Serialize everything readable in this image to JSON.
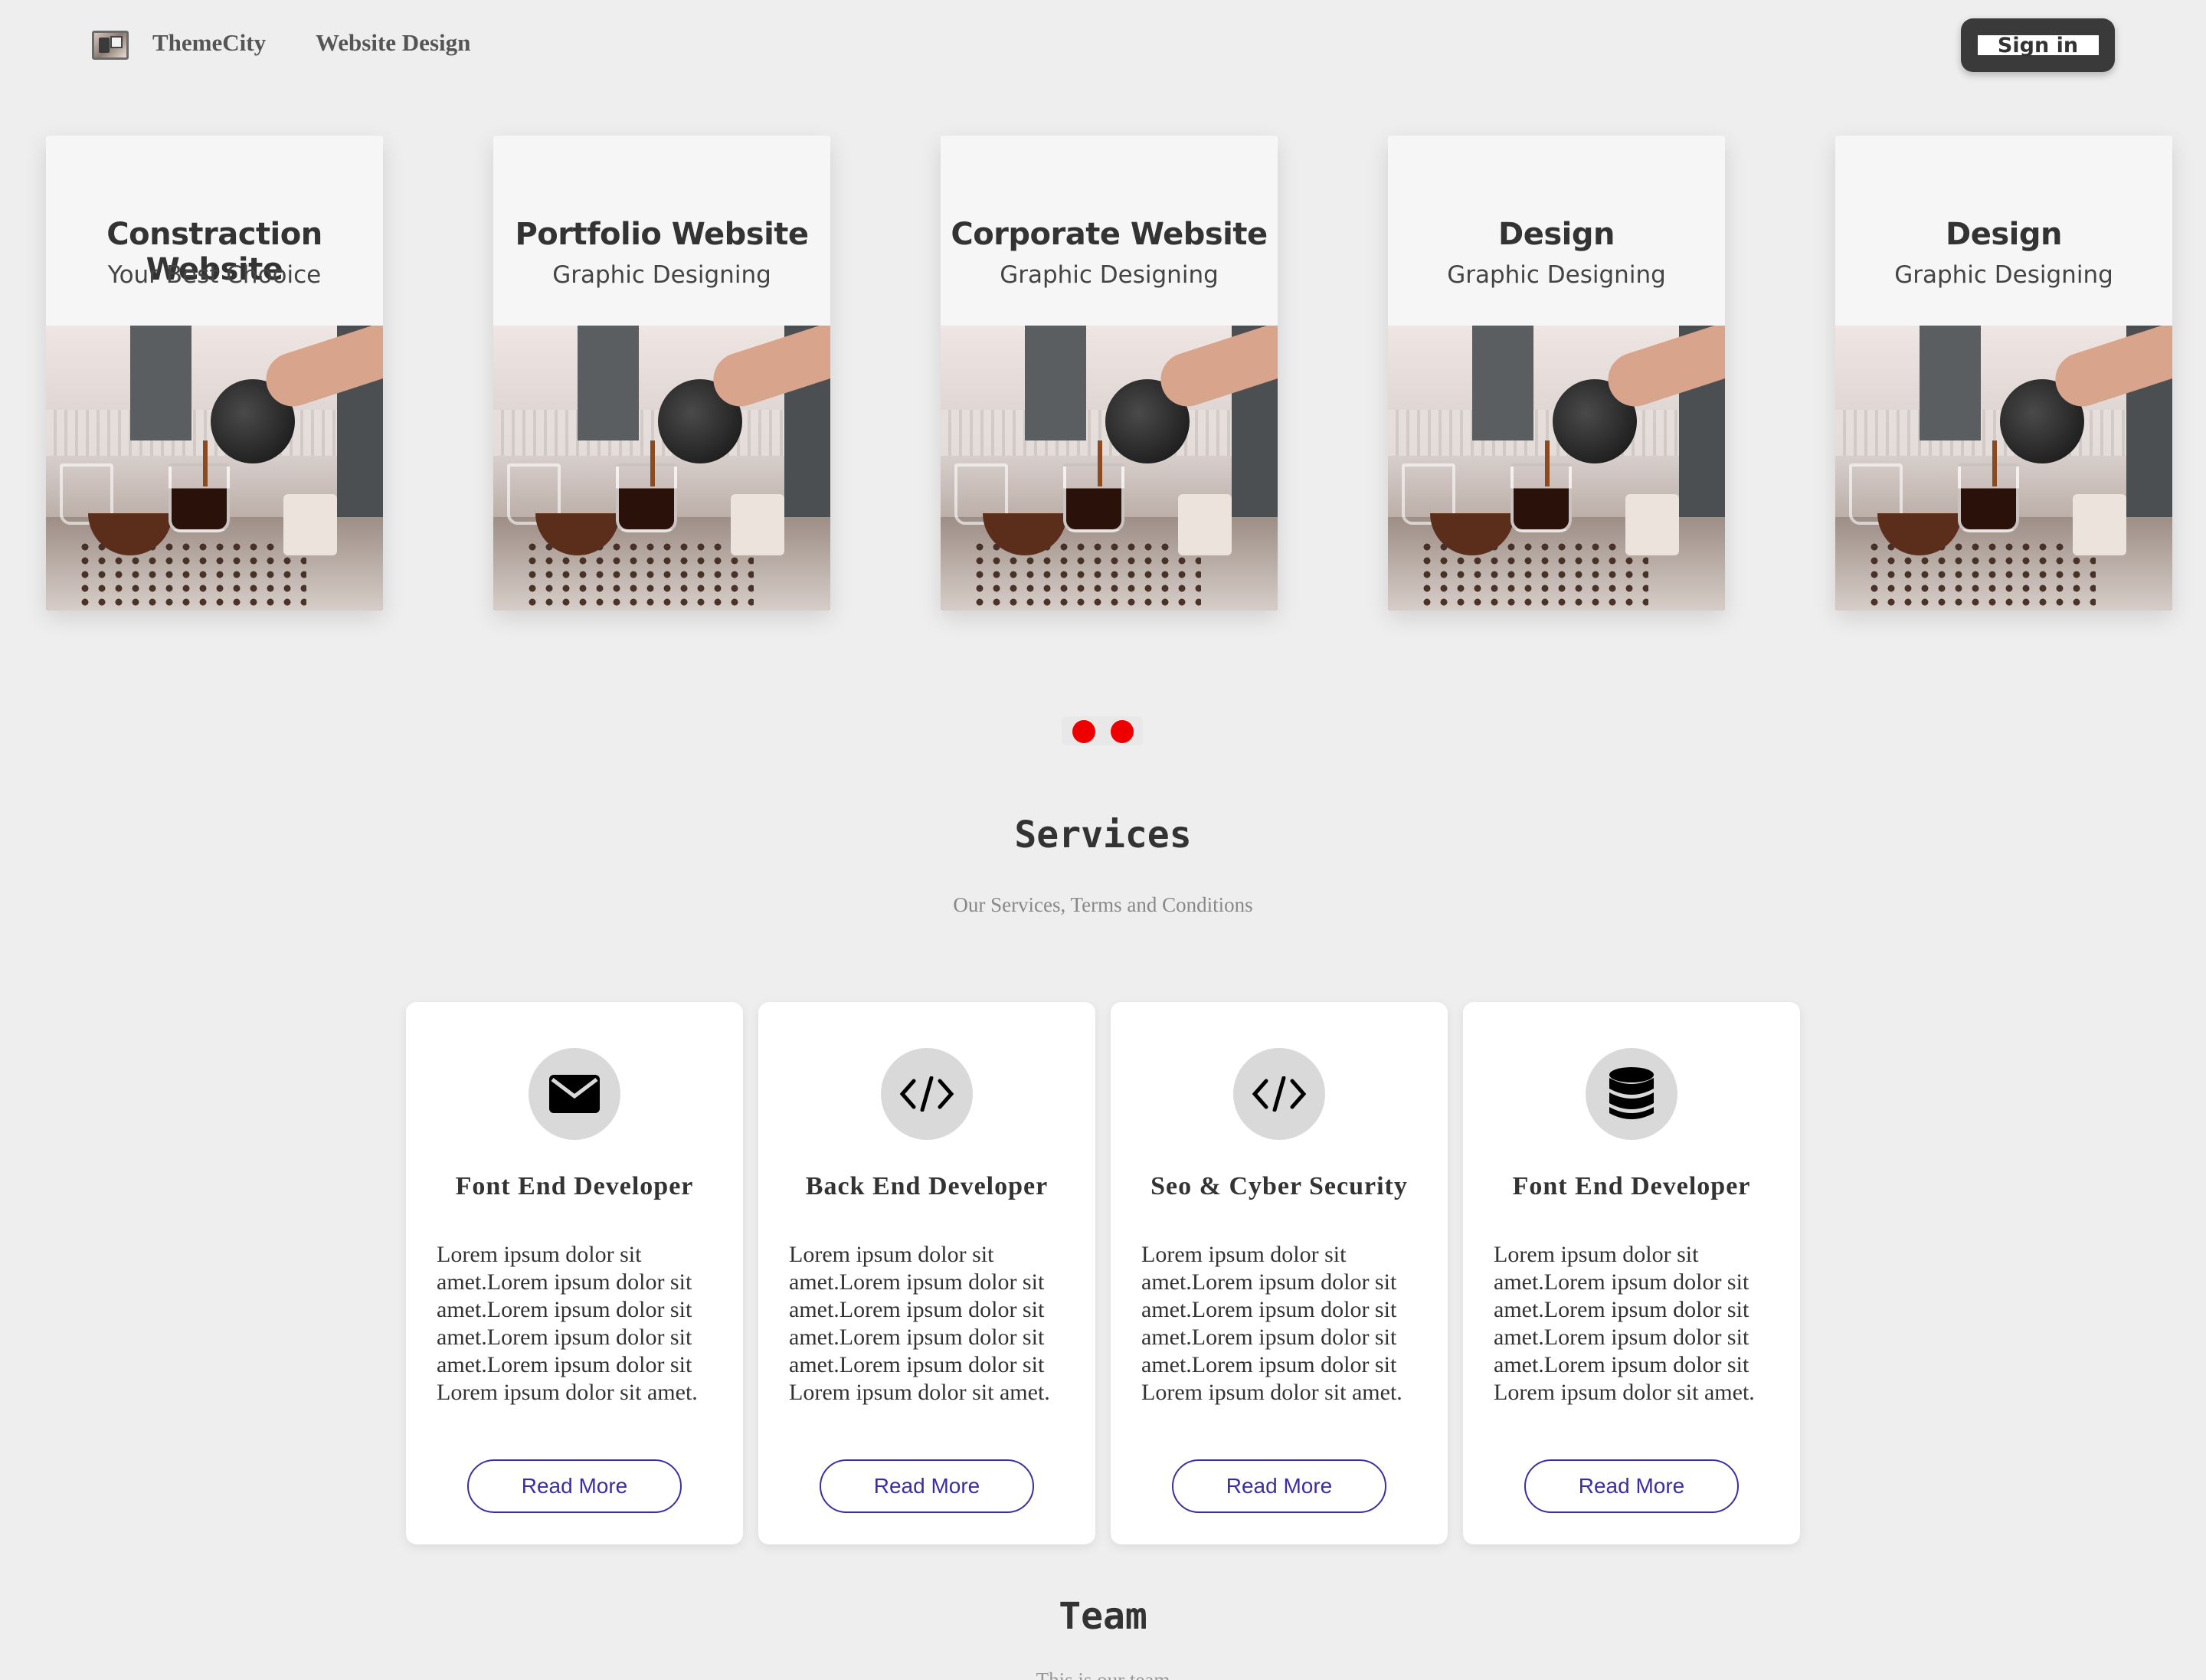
{
  "header": {
    "brand": "ThemeCity",
    "nav_link": "Website Design",
    "signin_label": "Sign in"
  },
  "carousel": {
    "slides": [
      {
        "title": "Constraction Website",
        "subtitle": "Your Best Chooice"
      },
      {
        "title": "Portfolio Website",
        "subtitle": "Graphic Designing"
      },
      {
        "title": "Corporate Website",
        "subtitle": "Graphic Designing"
      },
      {
        "title": "Design",
        "subtitle": "Graphic Designing"
      },
      {
        "title": "Design",
        "subtitle": "Graphic Designing"
      }
    ],
    "dot_color": "#ee0000",
    "image_subject": "coffee being poured from a pot into glass cups, coffee beans on table"
  },
  "services": {
    "title": "Services",
    "subtitle": "Our Services, Terms and Conditions",
    "cards": [
      {
        "icon": "envelope-icon",
        "title": "Font End Developer",
        "text": "Lorem ipsum dolor sit amet.Lorem ipsum dolor sit amet.Lorem ipsum dolor sit amet.Lorem ipsum dolor sit amet.Lorem ipsum dolor sit Lorem ipsum dolor sit amet.",
        "button": "Read More"
      },
      {
        "icon": "code-icon",
        "title": "Back End Developer",
        "text": "Lorem ipsum dolor sit amet.Lorem ipsum dolor sit amet.Lorem ipsum dolor sit amet.Lorem ipsum dolor sit amet.Lorem ipsum dolor sit Lorem ipsum dolor sit amet.",
        "button": "Read More"
      },
      {
        "icon": "code-icon",
        "title": "Seo & Cyber Security",
        "text": "Lorem ipsum dolor sit amet.Lorem ipsum dolor sit amet.Lorem ipsum dolor sit amet.Lorem ipsum dolor sit amet.Lorem ipsum dolor sit Lorem ipsum dolor sit amet.",
        "button": "Read More"
      },
      {
        "icon": "database-icon",
        "title": "Font End Developer",
        "text": "Lorem ipsum dolor sit amet.Lorem ipsum dolor sit amet.Lorem ipsum dolor sit amet.Lorem ipsum dolor sit amet.Lorem ipsum dolor sit Lorem ipsum dolor sit amet.",
        "button": "Read More"
      }
    ],
    "button_color": "#3a2fa0"
  },
  "team": {
    "title": "Team",
    "subtitle": "This is our team"
  }
}
